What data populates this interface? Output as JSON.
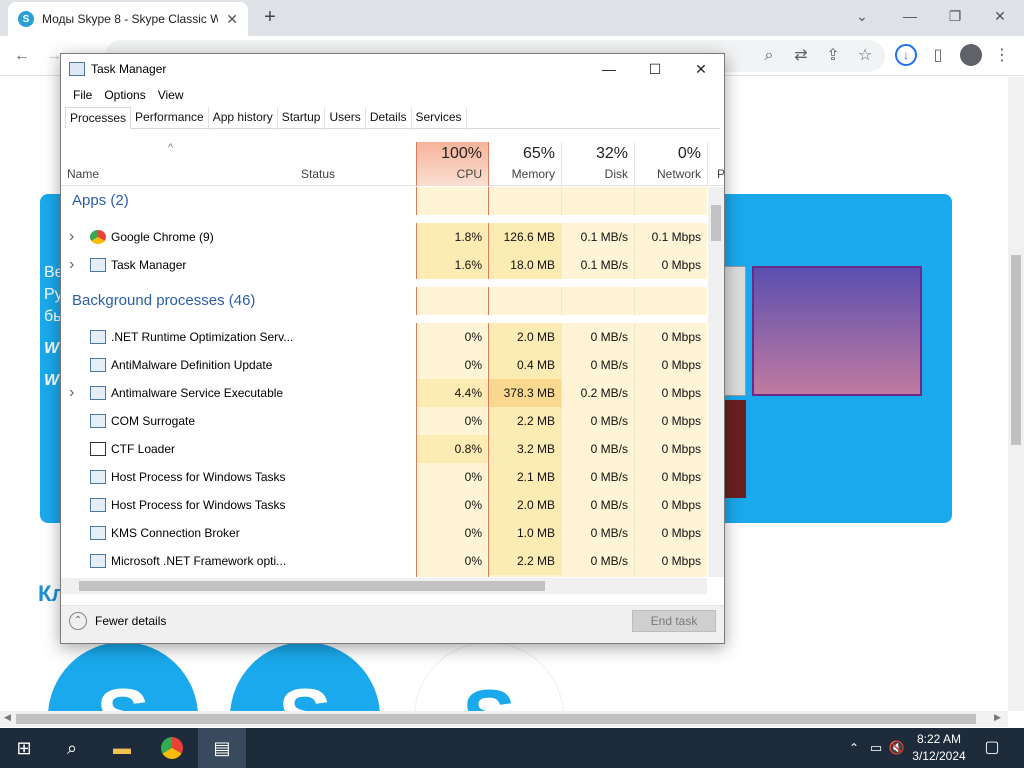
{
  "browser": {
    "tab_title": "Моды Skype 8 - Skype Classic W",
    "new_tab": "+",
    "window_controls": {
      "minimize": "—",
      "maximize": "❐",
      "close": "✕"
    },
    "toolbar_icons": [
      "back-icon",
      "forward-icon",
      "reload-icon",
      "search-icon",
      "translate-icon",
      "share-icon",
      "star-icon",
      "download-icon",
      "sidebar-icon",
      "profile-icon",
      "menu-icon"
    ]
  },
  "webpage": {
    "side_text": [
      "Ве",
      "Ру",
      "бь",
      "W",
      "W"
    ],
    "section_title": "Кл",
    "skype_letters": [
      "S",
      "S",
      "S"
    ]
  },
  "task_manager": {
    "title": "Task Manager",
    "controls": {
      "minimize": "—",
      "maximize": "☐",
      "close": "✕"
    },
    "menu": [
      "File",
      "Options",
      "View"
    ],
    "tabs": [
      "Processes",
      "Performance",
      "App history",
      "Startup",
      "Users",
      "Details",
      "Services"
    ],
    "active_tab": "Processes",
    "columns": {
      "name": "Name",
      "status": "Status",
      "cpu": {
        "pct": "100%",
        "label": "CPU"
      },
      "memory": {
        "pct": "65%",
        "label": "Memory"
      },
      "disk": {
        "pct": "32%",
        "label": "Disk"
      },
      "network": {
        "pct": "0%",
        "label": "Network"
      },
      "extra": "P"
    },
    "groups": {
      "apps": "Apps (2)",
      "background": "Background processes (46)"
    },
    "apps": [
      {
        "name": "Google Chrome (9)",
        "icon": "chrome-icon",
        "expand": true,
        "cpu": "1.8%",
        "memory": "126.6 MB",
        "disk": "0.1 MB/s",
        "network": "0.1 Mbps"
      },
      {
        "name": "Task Manager",
        "icon": "taskmanager-icon",
        "expand": true,
        "cpu": "1.6%",
        "memory": "18.0 MB",
        "disk": "0.1 MB/s",
        "network": "0 Mbps"
      }
    ],
    "background": [
      {
        "name": ".NET Runtime Optimization Serv...",
        "icon": "service-icon",
        "expand": false,
        "cpu": "0%",
        "memory": "2.0 MB",
        "disk": "0 MB/s",
        "network": "0 Mbps"
      },
      {
        "name": "AntiMalware Definition Update",
        "icon": "service-icon",
        "expand": false,
        "cpu": "0%",
        "memory": "0.4 MB",
        "disk": "0 MB/s",
        "network": "0 Mbps"
      },
      {
        "name": "Antimalware Service Executable",
        "icon": "service-icon",
        "expand": true,
        "cpu": "4.4%",
        "memory": "378.3 MB",
        "disk": "0.2 MB/s",
        "network": "0 Mbps"
      },
      {
        "name": "COM Surrogate",
        "icon": "service-icon",
        "expand": false,
        "cpu": "0%",
        "memory": "2.2 MB",
        "disk": "0 MB/s",
        "network": "0 Mbps"
      },
      {
        "name": "CTF Loader",
        "icon": "ctf-icon",
        "expand": false,
        "cpu": "0.8%",
        "memory": "3.2 MB",
        "disk": "0 MB/s",
        "network": "0 Mbps"
      },
      {
        "name": "Host Process for Windows Tasks",
        "icon": "service-icon",
        "expand": false,
        "cpu": "0%",
        "memory": "2.1 MB",
        "disk": "0 MB/s",
        "network": "0 Mbps"
      },
      {
        "name": "Host Process for Windows Tasks",
        "icon": "service-icon",
        "expand": false,
        "cpu": "0%",
        "memory": "2.0 MB",
        "disk": "0 MB/s",
        "network": "0 Mbps"
      },
      {
        "name": "KMS Connection Broker",
        "icon": "service-icon",
        "expand": false,
        "cpu": "0%",
        "memory": "1.0 MB",
        "disk": "0 MB/s",
        "network": "0 Mbps"
      },
      {
        "name": "Microsoft .NET Framework opti...",
        "icon": "service-icon",
        "expand": false,
        "cpu": "0%",
        "memory": "2.2 MB",
        "disk": "0 MB/s",
        "network": "0 Mbps"
      }
    ],
    "footer": {
      "fewer_details": "Fewer details",
      "end_task": "End task"
    }
  },
  "taskbar": {
    "time": "8:22 AM",
    "date": "3/12/2024",
    "icons": [
      "windows-start-icon",
      "search-icon",
      "file-explorer-icon",
      "chrome-icon",
      "taskmanager-icon"
    ]
  },
  "colors": {
    "cpu_header": "#f6b39a",
    "heat_low": "#fff4d6",
    "heat_mid": "#fdebb4",
    "heat_high": "#fbd890",
    "group_blue": "#2a5fa8",
    "web_blue": "#1aa9ec"
  }
}
